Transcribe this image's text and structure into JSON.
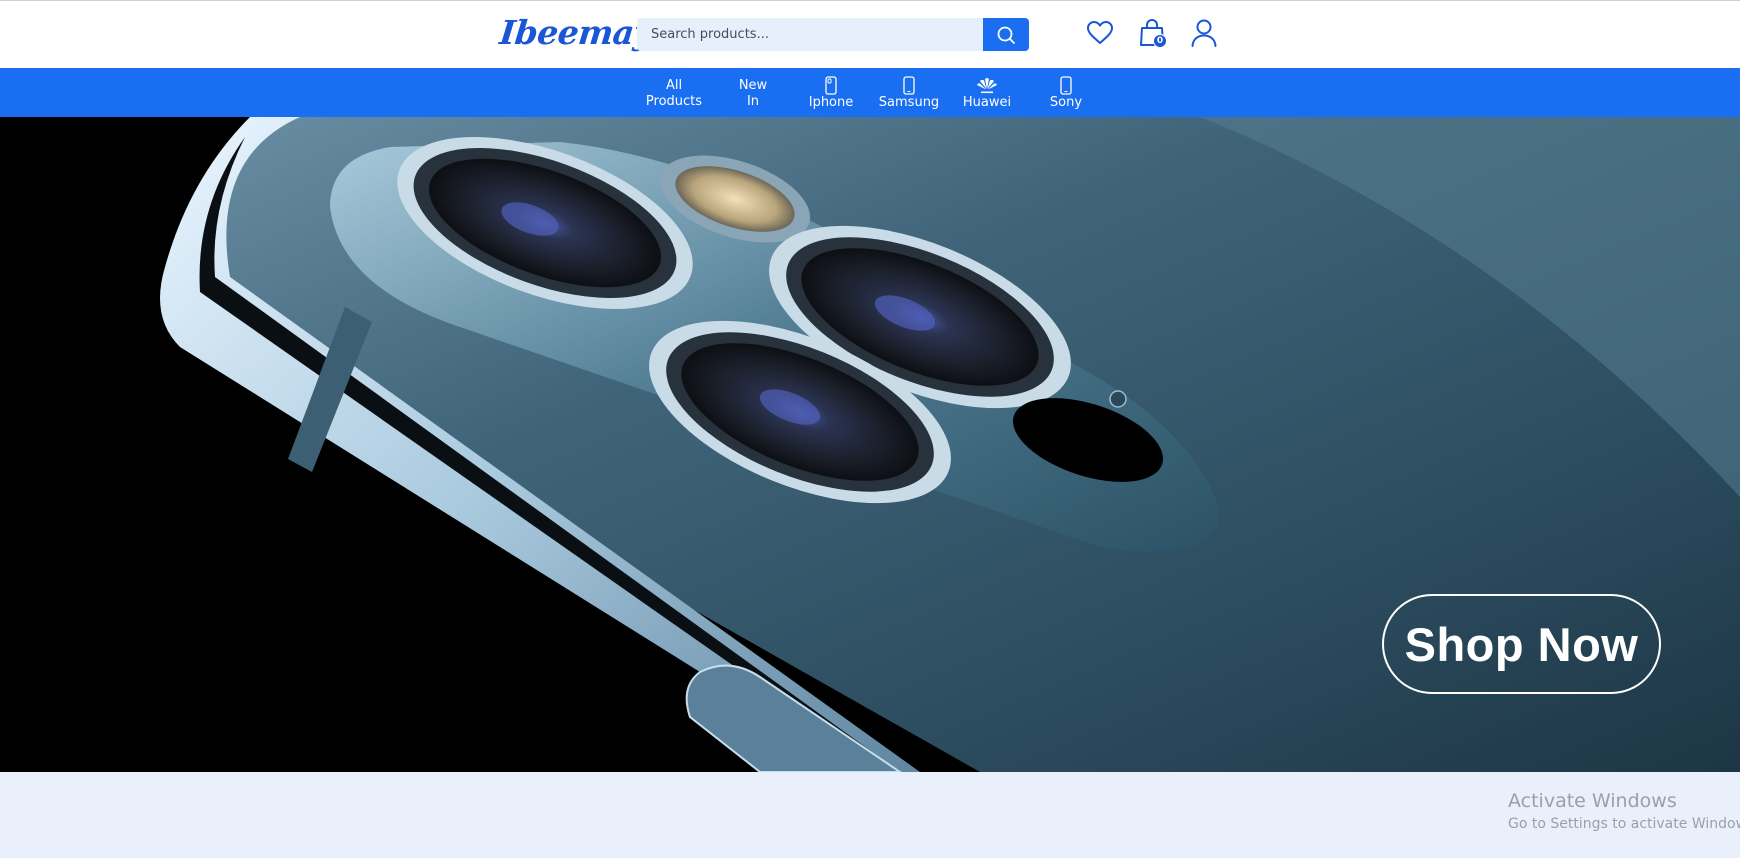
{
  "header": {
    "logo_text": "Ibeemay",
    "search": {
      "placeholder": "Search products...",
      "value": ""
    },
    "icons": {
      "search": "search-icon",
      "wishlist": "heart-icon",
      "cart": "shopping-bag-icon",
      "account": "user-icon"
    },
    "cart_count": "0"
  },
  "nav": {
    "items": [
      {
        "line1": "All",
        "line2": "Products"
      },
      {
        "line1": "New",
        "line2": "In"
      },
      {
        "label": "Iphone",
        "icon": "iphone-icon"
      },
      {
        "label": "Samsung",
        "icon": "smartphone-icon"
      },
      {
        "label": "Huawei",
        "icon": "huawei-logo-icon"
      },
      {
        "label": "Sony",
        "icon": "smartphone-icon"
      }
    ]
  },
  "hero": {
    "cta_label": "Shop Now"
  },
  "watermark": {
    "title": "Activate Windows",
    "subtitle": "Go to Settings to activate Windows."
  },
  "colors": {
    "brand_blue": "#1a6ef2",
    "logo_blue": "#1a56d6",
    "search_bg": "#e7eefc",
    "page_bg": "#e9effb"
  }
}
